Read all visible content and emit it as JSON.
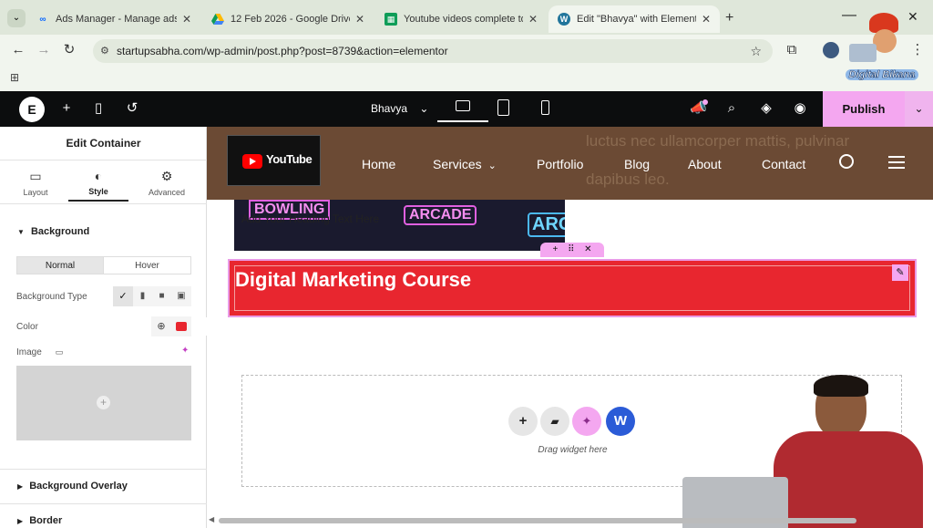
{
  "browser": {
    "tabs": [
      {
        "label": "Ads Manager - Manage ads - C",
        "icon": "meta-icon"
      },
      {
        "label": "12 Feb 2026 - Google Drive",
        "icon": "drive-icon"
      },
      {
        "label": "Youtube videos complete topic",
        "icon": "sheets-icon"
      },
      {
        "label": "Edit \"Bhavya\" with Elementor",
        "icon": "wordpress-icon"
      }
    ],
    "url": "startupsabha.com/wp-admin/post.php?post=8739&action=elementor"
  },
  "elementor": {
    "page_name": "Bhavya",
    "publish_label": "Publish"
  },
  "panel": {
    "title": "Edit Container",
    "tabs": [
      "Layout",
      "Style",
      "Advanced"
    ],
    "section_background": "Background",
    "normal_label": "Normal",
    "hover_label": "Hover",
    "bg_type_label": "Background Type",
    "color_label": "Color",
    "color_value": "#e8262f",
    "image_label": "Image",
    "bg_overlay": "Background Overlay",
    "border": "Border"
  },
  "site": {
    "logo_text": "YouTube",
    "nav": [
      "Home",
      "Services",
      "Portfolio",
      "Blog",
      "About",
      "Contact"
    ],
    "bg_text_line1": "luctus nec ullamcorper mattis, pulvinar",
    "bg_text_line2": "dapibus leo.",
    "hero_overlay": "Add Your Heading Text Here",
    "neon_bowling": "BOWLING",
    "neon_arcade": "ARCADE",
    "neon_arc": "ARC",
    "red_heading": "Digital Marketing Course",
    "drag_widget": "Drag widget here"
  },
  "overlay": {
    "channel_badge": "Digital Bikana"
  },
  "colors": {
    "header_bg": "#6b4a34",
    "red": "#e8262f",
    "accent_pink": "#f4a7f0",
    "topbar": "#0c0d0e"
  }
}
